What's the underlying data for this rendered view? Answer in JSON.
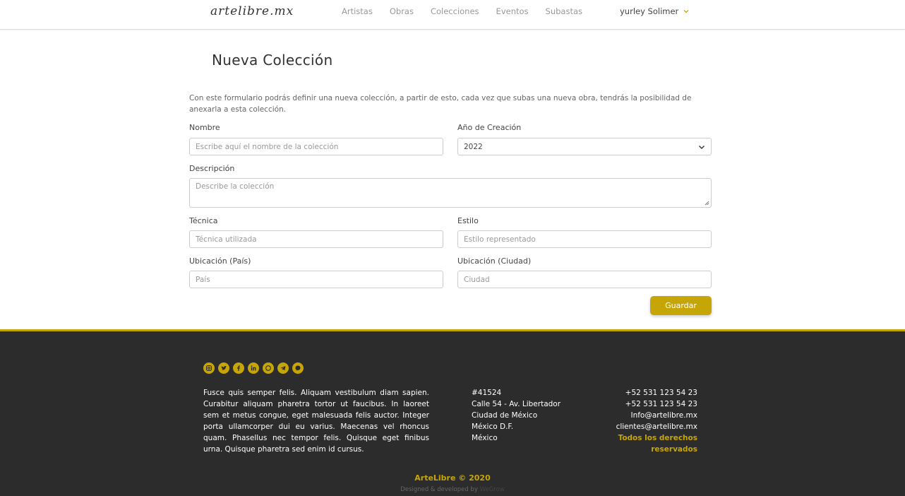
{
  "header": {
    "logo": "artelibre.mx",
    "nav": [
      "Artistas",
      "Obras",
      "Colecciones",
      "Eventos",
      "Subastas"
    ],
    "user_name": "yurley Solimer"
  },
  "form": {
    "title": "Nueva Colección",
    "intro": "Con este formulario podrás definir una nueva colección, a partir de esto, cada vez que subas una nueva obra, tendrás la posibilidad de anexarla a esta colección.",
    "nombre_label": "Nombre",
    "nombre_placeholder": "Escribe aquí el nombre de la colección",
    "anio_label": "Año de Creación",
    "anio_value": "2022",
    "descripcion_label": "Descripción",
    "descripcion_placeholder": "Describe la colección",
    "tecnica_label": "Técnica",
    "tecnica_placeholder": "Técnica utilizada",
    "estilo_label": "Estilo",
    "estilo_placeholder": "Estilo representado",
    "pais_label": "Ubicación (País)",
    "pais_placeholder": "País",
    "ciudad_label": "Ubicación (Ciudad)",
    "ciudad_placeholder": "Ciudad",
    "save_label": "Guardar"
  },
  "footer": {
    "social_icons": [
      "instagram-icon",
      "twitter-icon",
      "facebook-icon",
      "linkedin-icon",
      "whatsapp-icon",
      "telegram-icon",
      "messenger-icon"
    ],
    "about": "Fusce quis semper felis. Aliquam vestibulum diam sapien. Curabitur aliquam pharetra tortor ut faucibus. In laoreet sem et metus congue, eget malesuada felis auctor. Integer porta ullamcorper dui eu varius. Maecenas vel rhoncus quam. Phasellus nec tempor felis. Quisque eget finibus urna. Quisque pharetra sed enim id cursus.",
    "address": [
      "#41524",
      "Calle 54 - Av. Libertador",
      "Ciudad de México",
      "México D.F.",
      "México"
    ],
    "contact": [
      "+52 531 123 54 23",
      "+52 531 123 54 23",
      "Info@artelibre.mx",
      "clientes@artelibre.mx"
    ],
    "rights": "Todos los derechos reservados",
    "copyright": "ArteLibre © 2020",
    "designed_prefix": "Designed & developed by",
    "designed_brand": "WeGrow"
  },
  "colors": {
    "accent": "#c6a507",
    "footer_bg": "#2c2c2c"
  }
}
